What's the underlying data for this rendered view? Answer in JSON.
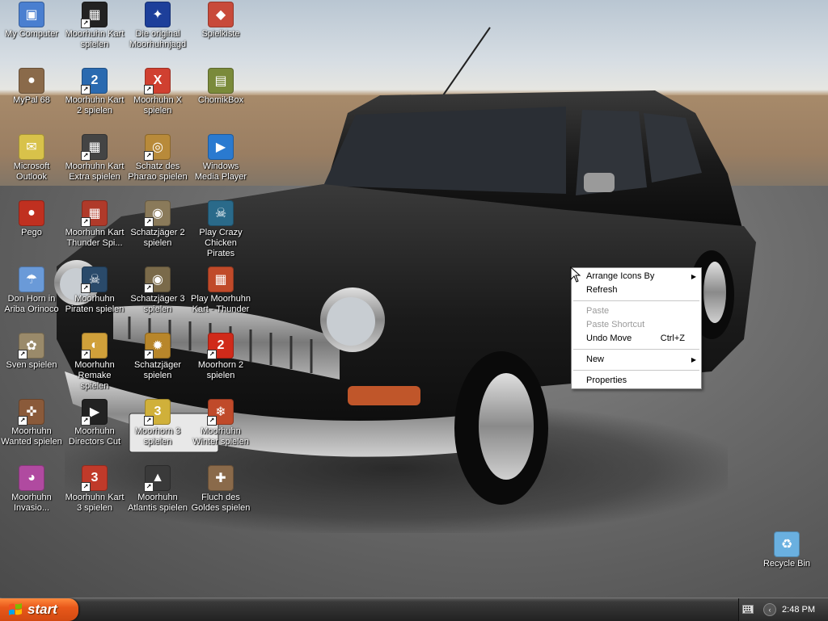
{
  "desktop": {
    "icons": [
      {
        "label": "My Computer",
        "shortcut": false,
        "color": "#4a7fd0",
        "glyph": "▣"
      },
      {
        "label": "Moorhuhn Kart spielen",
        "shortcut": true,
        "color": "#222222",
        "glyph": "▦"
      },
      {
        "label": "Die original Moorhuhnjagd",
        "shortcut": false,
        "color": "#1d3f9a",
        "glyph": "✦"
      },
      {
        "label": "Spielkiste",
        "shortcut": false,
        "color": "#c84a3a",
        "glyph": "◆"
      },
      {
        "label": "MyPal 68",
        "shortcut": false,
        "color": "#8a6a4a",
        "glyph": "●"
      },
      {
        "label": "Moorhuhn Kart 2 spielen",
        "shortcut": true,
        "color": "#2a6ab0",
        "glyph": "2"
      },
      {
        "label": "Moorhuhn X spielen",
        "shortcut": true,
        "color": "#d04030",
        "glyph": "X"
      },
      {
        "label": "ChomikBox",
        "shortcut": false,
        "color": "#7a8a3a",
        "glyph": "▤"
      },
      {
        "label": "Microsoft Outlook",
        "shortcut": false,
        "color": "#d8c24a",
        "glyph": "✉"
      },
      {
        "label": "Moorhuhn Kart Extra spielen",
        "shortcut": true,
        "color": "#444444",
        "glyph": "▦"
      },
      {
        "label": "Schatz des Pharao spielen",
        "shortcut": true,
        "color": "#b88a3a",
        "glyph": "◎"
      },
      {
        "label": "Windows Media Player",
        "shortcut": false,
        "color": "#2a7ad0",
        "glyph": "▶"
      },
      {
        "label": "Pego",
        "shortcut": false,
        "color": "#c03020",
        "glyph": "●"
      },
      {
        "label": "Moorhuhn Kart Thunder Spi...",
        "shortcut": true,
        "color": "#b03a2a",
        "glyph": "▦"
      },
      {
        "label": "Schatzjäger 2 spielen",
        "shortcut": true,
        "color": "#8a7a5a",
        "glyph": "◉"
      },
      {
        "label": "Play Crazy Chicken Pirates",
        "shortcut": false,
        "color": "#2a6a8a",
        "glyph": "☠"
      },
      {
        "label": "Don Horn in Ariba Orinoco",
        "shortcut": false,
        "color": "#6a9ad8",
        "glyph": "☂"
      },
      {
        "label": "Moorhuhn Piraten spielen",
        "shortcut": true,
        "color": "#2a4a6a",
        "glyph": "☠"
      },
      {
        "label": "Schatzjäger 3 spielen",
        "shortcut": true,
        "color": "#7a6a4a",
        "glyph": "◉"
      },
      {
        "label": "Play Moorhuhn Kart - Thunder",
        "shortcut": false,
        "color": "#c04a2a",
        "glyph": "▦"
      },
      {
        "label": "Sven spielen",
        "shortcut": true,
        "color": "#9a8a6a",
        "glyph": "✿"
      },
      {
        "label": "Moorhuhn Remake spielen",
        "shortcut": true,
        "color": "#d0a03a",
        "glyph": "◐"
      },
      {
        "label": "Schatzjäger spielen",
        "shortcut": true,
        "color": "#b8862a",
        "glyph": "✹"
      },
      {
        "label": "Moorhorn 2 spielen",
        "shortcut": true,
        "color": "#d02a1a",
        "glyph": "2"
      },
      {
        "label": "Moorhuhn Wanted spielen",
        "shortcut": true,
        "color": "#8a5a3a",
        "glyph": "✜"
      },
      {
        "label": "Moorhuhn Directors Cut",
        "shortcut": true,
        "color": "#222222",
        "glyph": "▶"
      },
      {
        "label": "Moorhorn 3 spielen",
        "shortcut": true,
        "color": "#d0b03a",
        "glyph": "3"
      },
      {
        "label": "Moorhuhn Winter spielen",
        "shortcut": true,
        "color": "#c04a2a",
        "glyph": "❄"
      },
      {
        "label": "Moorhuhn Invasio...",
        "shortcut": false,
        "color": "#b04aa0",
        "glyph": "◕"
      },
      {
        "label": "Moorhuhn Kart 3 spielen",
        "shortcut": true,
        "color": "#c03a2a",
        "glyph": "3"
      },
      {
        "label": "Moorhuhn Atlantis spielen",
        "shortcut": true,
        "color": "#3a3a3a",
        "glyph": "▲"
      },
      {
        "label": "Fluch des Goldes spielen",
        "shortcut": false,
        "color": "#8a6a4a",
        "glyph": "✚"
      },
      {
        "label": "Recycle Bin",
        "shortcut": false,
        "color": "#6ab0e0",
        "glyph": "♻"
      }
    ]
  },
  "context_menu": {
    "items": [
      {
        "type": "item",
        "label": "Arrange Icons By",
        "submenu": true,
        "disabled": false
      },
      {
        "type": "item",
        "label": "Refresh",
        "submenu": false,
        "disabled": false
      },
      {
        "type": "separator"
      },
      {
        "type": "item",
        "label": "Paste",
        "submenu": false,
        "disabled": true
      },
      {
        "type": "item",
        "label": "Paste Shortcut",
        "submenu": false,
        "disabled": true
      },
      {
        "type": "item",
        "label": "Undo Move",
        "shortcut": "Ctrl+Z",
        "submenu": false,
        "disabled": false
      },
      {
        "type": "separator"
      },
      {
        "type": "item",
        "label": "New",
        "submenu": true,
        "disabled": false
      },
      {
        "type": "separator"
      },
      {
        "type": "item",
        "label": "Properties",
        "submenu": false,
        "disabled": false
      }
    ]
  },
  "taskbar": {
    "start_label": "start",
    "clock": "2:48 PM",
    "tray_chevron": "‹"
  },
  "colors": {
    "start_button": "#e8581a",
    "taskbar": "#2d2d2d"
  }
}
